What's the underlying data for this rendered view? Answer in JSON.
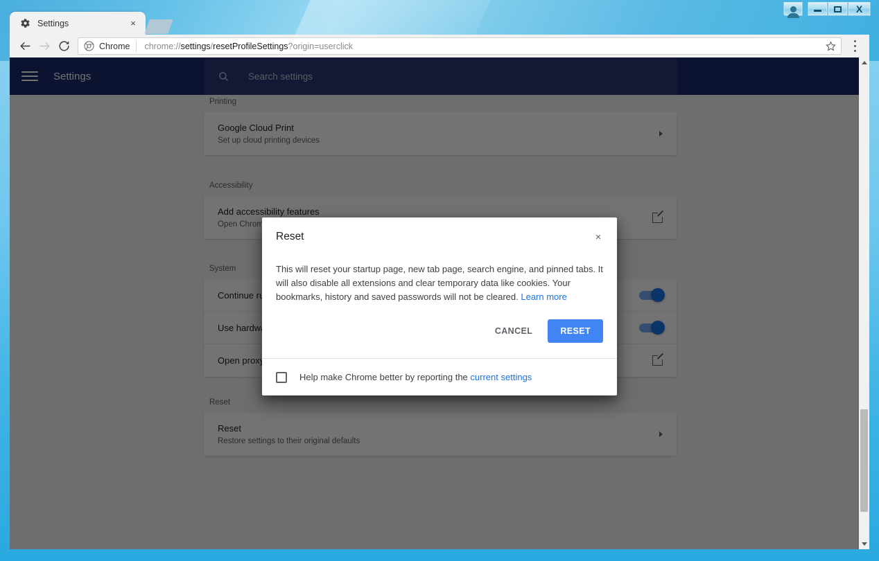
{
  "window": {
    "caption_buttons": [
      {
        "name": "user-account",
        "glyph": "user"
      },
      {
        "name": "minimize",
        "glyph": "minimize"
      },
      {
        "name": "maximize",
        "glyph": "maximize"
      },
      {
        "name": "close",
        "label": "X"
      }
    ]
  },
  "tab": {
    "title": "Settings",
    "favicon": "gear-icon",
    "close_label": "×",
    "new_tab_tooltip": "New tab"
  },
  "toolbar": {
    "back_icon": "back-arrow-icon",
    "forward_icon": "forward-arrow-icon",
    "reload_icon": "reload-icon",
    "security_chip_label": "Chrome",
    "url_prefix": "chrome://",
    "url_emphasis_1": "settings",
    "url_middle": "/",
    "url_emphasis_2": "resetProfileSettings",
    "url_suffix": "?origin=userclick",
    "url_full": "chrome://settings/resetProfileSettings?origin=userclick",
    "star_icon": "star-icon",
    "menu_icon": "three-dot-menu-icon"
  },
  "settings_header": {
    "menu_icon": "hamburger-icon",
    "title": "Settings",
    "search_icon": "search-icon",
    "search_placeholder": "Search settings",
    "search_value": "",
    "background_color": "#1b2a6b"
  },
  "sections": [
    {
      "label": "Printing",
      "rows": [
        {
          "title": "Google Cloud Print",
          "sub": "Set up cloud printing devices",
          "action": "chevron"
        }
      ]
    },
    {
      "label": "Accessibility",
      "rows": [
        {
          "title": "Add accessibility features",
          "sub": "Open Chrome Web Store",
          "action": "external-link"
        }
      ]
    },
    {
      "label": "System",
      "rows": [
        {
          "title": "Continue running background apps when Google Chrome is closed",
          "sub": "",
          "action": "toggle-on"
        },
        {
          "title": "Use hardware acceleration when available",
          "sub": "",
          "action": "toggle-on"
        },
        {
          "title": "Open proxy settings",
          "sub": "",
          "action": "external-link"
        }
      ]
    },
    {
      "label": "Reset",
      "rows": [
        {
          "title": "Reset",
          "sub": "Restore settings to their original defaults",
          "action": "chevron"
        }
      ]
    }
  ],
  "dialog": {
    "title": "Reset",
    "close_label": "×",
    "body_text": "This will reset your startup page, new tab page, search engine, and pinned tabs. It will also disable all extensions and clear temporary data like cookies. Your bookmarks, history and saved passwords will not be cleared.",
    "learn_more_label": "Learn more",
    "cancel_label": "CANCEL",
    "confirm_label": "RESET",
    "confirm_color": "#4285f4",
    "link_color": "#1a73e8",
    "checkbox_checked": false,
    "footer_text_before": "Help make Chrome better by reporting the",
    "footer_link_label": "current settings"
  },
  "scrollbar": {
    "up_icon": "scroll-up-arrow-icon",
    "down_icon": "scroll-down-arrow-icon",
    "thumb": "scrollbar-thumb"
  }
}
